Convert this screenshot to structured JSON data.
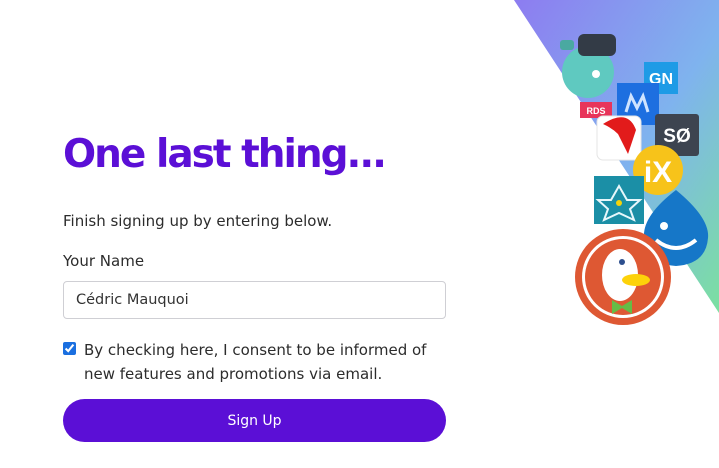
{
  "signup": {
    "title": "One last thing...",
    "subtitle": "Finish signing up by entering below.",
    "name_label": "Your Name",
    "name_value": "Cédric Mauquoi",
    "consent_checked": true,
    "consent_text": "By checking here, I consent to be informed of new features and promotions via email.",
    "submit_label": "Sign Up"
  },
  "decoration": {
    "logos": [
      {
        "icon": "robot-mascot-icon"
      },
      {
        "text": "GN"
      },
      {
        "icon": "mj-monogram-icon"
      },
      {
        "text": "RDS"
      },
      {
        "icon": "red-swoosh-icon"
      },
      {
        "text": "SØ"
      },
      {
        "text": "iX"
      },
      {
        "icon": "geometric-star-icon"
      },
      {
        "icon": "drupal-drop-icon"
      },
      {
        "icon": "duckduckgo-icon"
      }
    ]
  },
  "colors": {
    "accent": "#5b0fd6",
    "gradient_start": "#8d7cf0",
    "gradient_end": "#7be0a0"
  }
}
